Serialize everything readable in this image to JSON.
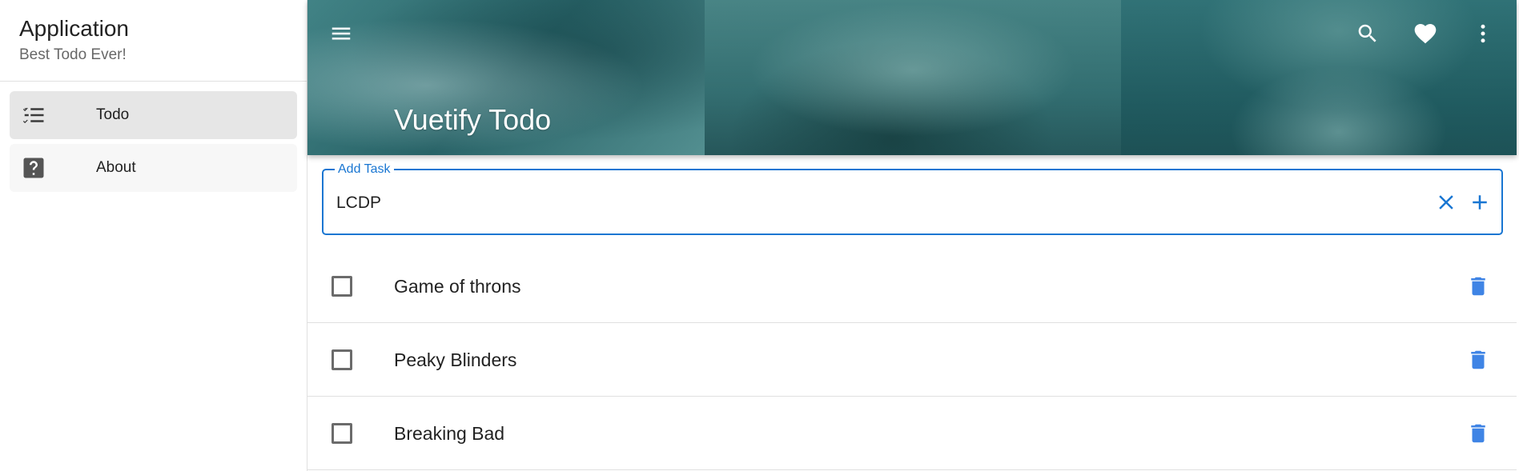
{
  "drawer": {
    "title": "Application",
    "subtitle": "Best Todo Ever!",
    "items": [
      {
        "label": "Todo",
        "icon": "format-list-checks-icon",
        "active": true
      },
      {
        "label": "About",
        "icon": "help-box-icon",
        "active": false
      }
    ]
  },
  "appbar": {
    "title": "Vuetify Todo",
    "icons": [
      "menu-icon",
      "search-icon",
      "heart-icon",
      "more-vertical-icon"
    ]
  },
  "add_task": {
    "label": "Add Task",
    "value": "LCDP",
    "icons": [
      "close-icon",
      "plus-icon"
    ]
  },
  "tasks": [
    {
      "title": "Game of throns",
      "done": false
    },
    {
      "title": "Peaky Blinders",
      "done": false
    },
    {
      "title": "Breaking Bad",
      "done": false
    }
  ],
  "colors": {
    "primary": "#1976d2",
    "delete_icon": "#3f84e5",
    "nav_active_bg": "#e6e6e6",
    "banner_tint": "#2f6b6f"
  }
}
